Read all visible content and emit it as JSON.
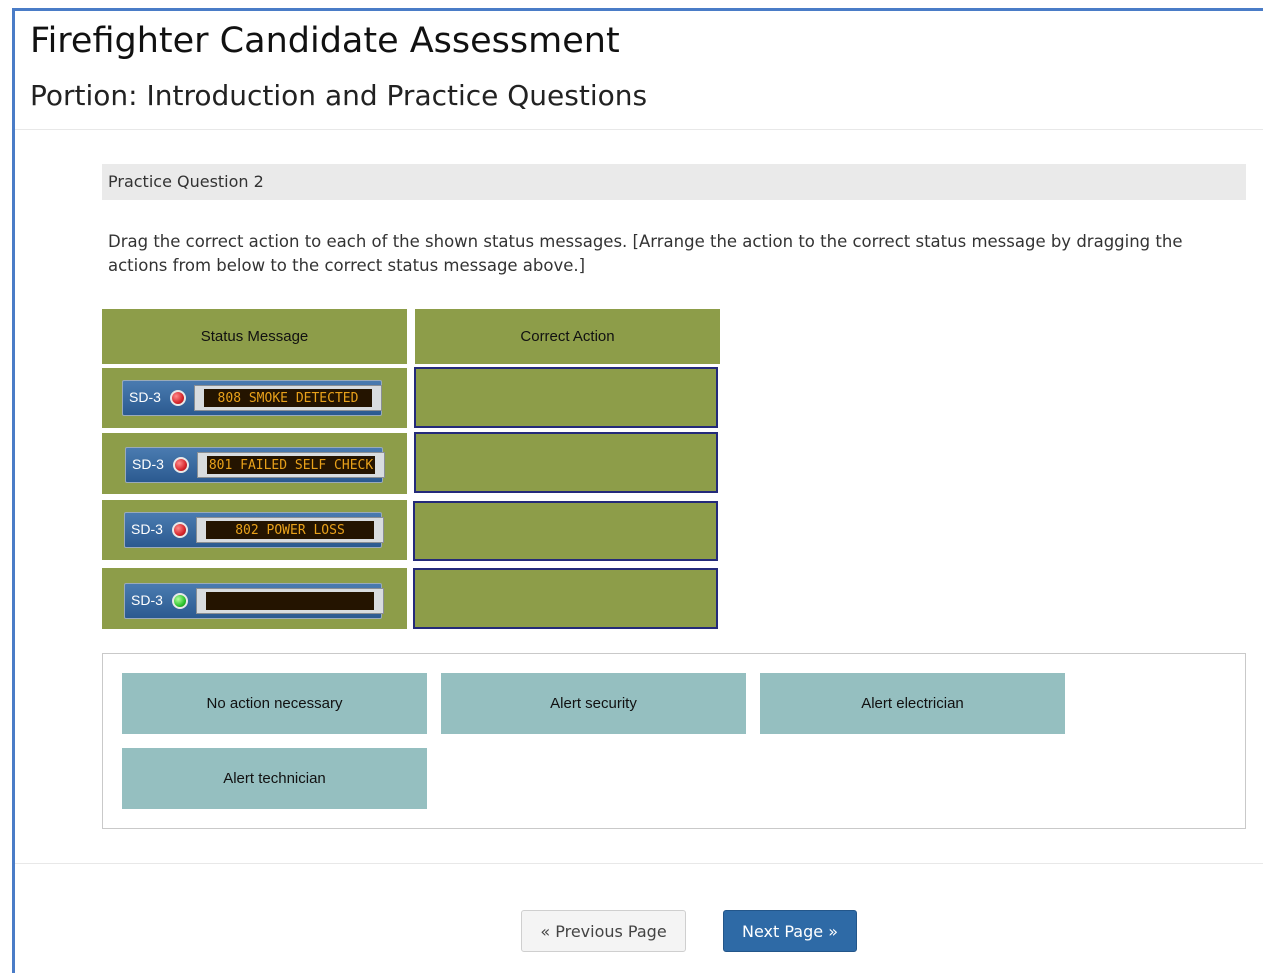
{
  "header": {
    "title": "Firefighter Candidate Assessment",
    "portion": "Portion: Introduction and Practice Questions"
  },
  "question": {
    "label": "Practice Question 2",
    "instructions": "Drag the correct action to each of the shown status messages. [Arrange the action to the correct status message by dragging the actions from below to the correct status message above.]"
  },
  "table": {
    "col_status": "Status Message",
    "col_action": "Correct Action",
    "rows": [
      {
        "device": "SD-3",
        "led": "red",
        "message": "808 SMOKE DETECTED"
      },
      {
        "device": "SD-3",
        "led": "red",
        "message": "801 FAILED SELF CHECK"
      },
      {
        "device": "SD-3",
        "led": "red",
        "message": "802 POWER LOSS"
      },
      {
        "device": "SD-3",
        "led": "green",
        "message": ""
      }
    ]
  },
  "actions": [
    "No action necessary",
    "Alert security",
    "Alert electrician",
    "Alert technician"
  ],
  "nav": {
    "prev": "« Previous Page",
    "next": "Next Page »"
  },
  "colors": {
    "frame_border": "#4a7cc7",
    "cell_olive": "#8d9d49",
    "action_tile": "#95bfc0",
    "next_button": "#2e6aa6"
  }
}
